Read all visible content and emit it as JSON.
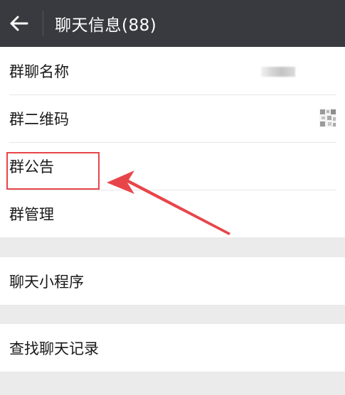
{
  "header": {
    "back_icon": "arrow-left-icon",
    "title": "聊天信息(88)"
  },
  "group_section": {
    "items": [
      {
        "label": "群聊名称"
      },
      {
        "label": "群二维码",
        "icon": "qr-code-icon"
      },
      {
        "label": "群公告"
      },
      {
        "label": "群管理"
      }
    ]
  },
  "mini_program": {
    "label": "聊天小程序"
  },
  "history": {
    "label": "查找聊天记录"
  },
  "colors": {
    "header_bg": "#393a3f",
    "page_bg": "#ebebeb",
    "annotation": "#e8454a"
  }
}
